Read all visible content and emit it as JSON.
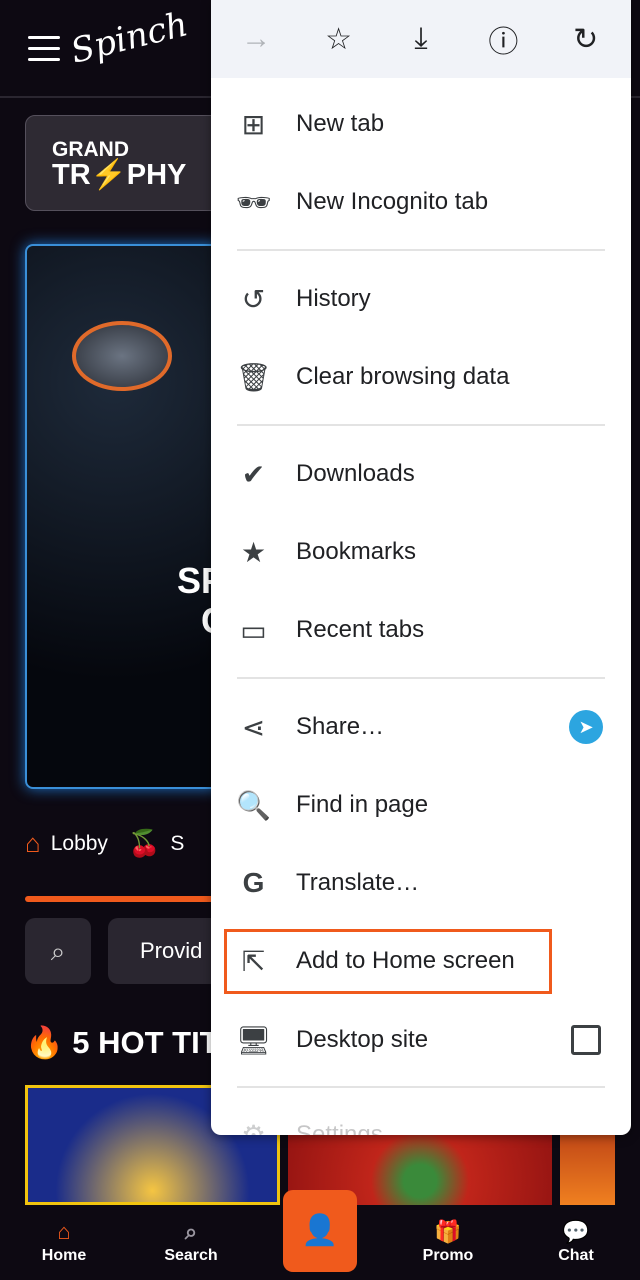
{
  "site": {
    "logo": "Spinch",
    "promo_line1": "GRAND",
    "promo_line2": "TR⚡PHY",
    "banner_text_line1": "SP",
    "banner_text_line2": "C",
    "tabs": [
      {
        "label": "Lobby",
        "icon": "home-icon"
      },
      {
        "label": "S",
        "icon": "cherry-icon"
      }
    ],
    "providers_label": "Provid",
    "hot_title": "5 HOT TIT",
    "nav": [
      {
        "label": "Home",
        "icon": "home-icon"
      },
      {
        "label": "Search",
        "icon": "search-icon"
      },
      {
        "label": "",
        "icon": "user-icon"
      },
      {
        "label": "Promo",
        "icon": "gift-icon"
      },
      {
        "label": "Chat",
        "icon": "chat-icon"
      }
    ]
  },
  "menu": {
    "toolbar": [
      {
        "icon": "forward-icon",
        "glyph": "→",
        "enabled": false
      },
      {
        "icon": "star-icon",
        "glyph": "☆",
        "enabled": true
      },
      {
        "icon": "download-icon",
        "glyph": "⤓",
        "enabled": true
      },
      {
        "icon": "info-icon",
        "glyph": "ⓘ",
        "enabled": true
      },
      {
        "icon": "refresh-icon",
        "glyph": "↻",
        "enabled": true
      }
    ],
    "items": [
      {
        "label": "New tab",
        "icon": "plus-box-icon",
        "glyph": "⊞"
      },
      {
        "label": "New Incognito tab",
        "icon": "incognito-icon",
        "glyph": "🕶"
      },
      {
        "label": "History",
        "icon": "history-icon",
        "glyph": "↺"
      },
      {
        "label": "Clear browsing data",
        "icon": "trash-icon",
        "glyph": "🗑"
      },
      {
        "label": "Downloads",
        "icon": "downloads-check-icon",
        "glyph": "✔"
      },
      {
        "label": "Bookmarks",
        "icon": "star-filled-icon",
        "glyph": "★"
      },
      {
        "label": "Recent tabs",
        "icon": "devices-icon",
        "glyph": "▭"
      },
      {
        "label": "Share…",
        "icon": "share-icon",
        "glyph": "⋖"
      },
      {
        "label": "Find in page",
        "icon": "find-in-page-icon",
        "glyph": "🔍"
      },
      {
        "label": "Translate…",
        "icon": "translate-icon",
        "glyph": "G"
      },
      {
        "label": "Add to Home screen",
        "icon": "add-to-home-icon",
        "glyph": "⇱"
      },
      {
        "label": "Desktop site",
        "icon": "desktop-icon",
        "glyph": "🖥",
        "checked": false
      },
      {
        "label": "Settings",
        "icon": "gear-icon",
        "glyph": "⚙"
      }
    ],
    "highlight_color": "#f05a1c"
  },
  "colors": {
    "accent": "#f05a1c",
    "bg": "#0d0912"
  }
}
